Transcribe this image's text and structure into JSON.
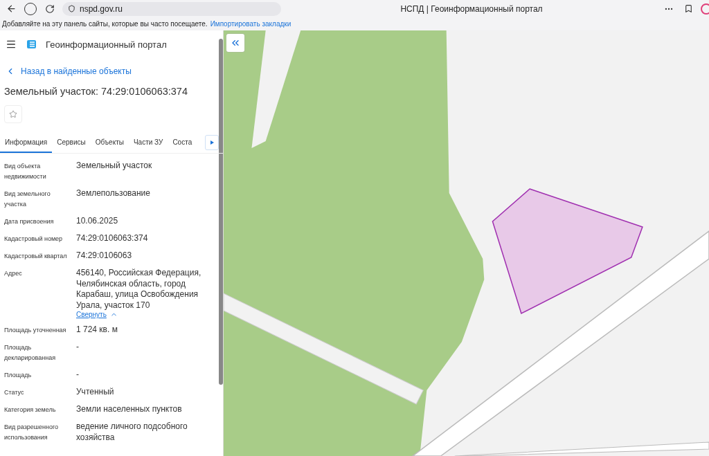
{
  "browser": {
    "address": "nspd.gov.ru",
    "title": "НСПД | Геоинформационный портал",
    "bookmarks_hint": "Добавляйте на эту панель сайты, которые вы часто посещаете.",
    "bookmarks_link": "Импортировать закладки"
  },
  "app": {
    "title": "Геоинформационный портал",
    "back_link": "Назад в найденные объекты",
    "heading": "Земельный участок: 74:29:0106063:374",
    "favorite": false
  },
  "tabs": [
    {
      "label": "Информация",
      "selected": true
    },
    {
      "label": "Сервисы",
      "selected": false
    },
    {
      "label": "Объекты",
      "selected": false
    },
    {
      "label": "Части ЗУ",
      "selected": false
    },
    {
      "label": "Соста",
      "selected": false
    }
  ],
  "fields": [
    {
      "label": "Вид объекта недвижимости",
      "value": "Земельный участок"
    },
    {
      "label": "Вид земельного участка",
      "value": "Землепользование"
    },
    {
      "label": "Дата присвоения",
      "value": "10.06.2025"
    },
    {
      "label": "Кадастровый номер",
      "value": "74:29:0106063:374"
    },
    {
      "label": "Кадастровый квартал",
      "value": "74:29:0106063"
    },
    {
      "label": "Адрес",
      "value": "456140, Российская Федерация, Челябинская область, город Карабаш, улица Освобождения Урала, участок 170",
      "action": "Свернуть"
    },
    {
      "label": "Площадь уточненная",
      "value": "1 724 кв. м"
    },
    {
      "label": "Площадь декларированная",
      "value": "-"
    },
    {
      "label": "Площадь",
      "value": "-"
    },
    {
      "label": "Статус",
      "value": "Учтенный"
    },
    {
      "label": "Категория земель",
      "value": "Земли населенных пунктов"
    },
    {
      "label": "Вид разрешенного использования",
      "value": "ведение личного подсобного хозяйства"
    }
  ]
}
